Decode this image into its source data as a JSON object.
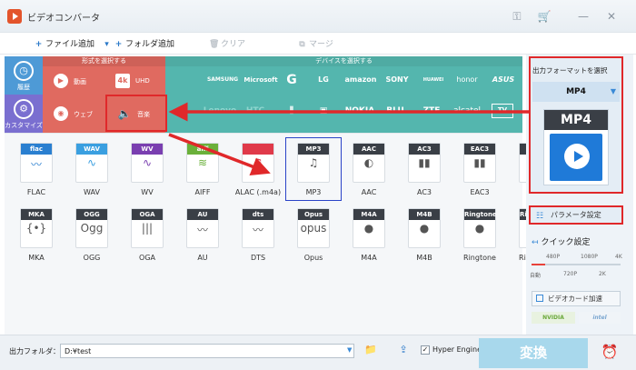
{
  "app": {
    "title": "ビデオコンバータ"
  },
  "window_icons": [
    "key-icon",
    "cart-icon",
    "minimize-icon",
    "close-icon"
  ],
  "toolbar": {
    "add_file": "ファイル追加",
    "add_folder": "フォルダ追加",
    "clear": "クリア",
    "merge": "マージ"
  },
  "nav": {
    "history": "履歴",
    "customize": "カスタマイズ"
  },
  "format_panel": {
    "header": "形式を選択する",
    "video": "動画",
    "uhd": "UHD",
    "web": "ウェブ",
    "music": "音楽"
  },
  "device_panel": {
    "header": "デバイスを選択する",
    "brands_row1": [
      "",
      "SAMSUNG",
      "Microsoft",
      "G",
      "LG",
      "amazon",
      "SONY",
      "HUAWEI",
      "honor",
      "ASUS"
    ],
    "brands_row2": [
      "Lenovo",
      "HTC",
      "",
      "",
      "NOKIA",
      "BLU",
      "ZTE",
      "alcatel",
      "TV"
    ]
  },
  "formats": [
    {
      "badge": "flac",
      "label": "FLAC",
      "color": "#2a7fd0"
    },
    {
      "badge": "WAV",
      "label": "WAV",
      "color": "#3a9fe0"
    },
    {
      "badge": "WV",
      "label": "WV",
      "color": "#7a3fb0"
    },
    {
      "badge": "aiff",
      "label": "AIFF",
      "color": "#6ab03a"
    },
    {
      "badge": "",
      "label": "ALAC (.m4a)",
      "color": "#e03a4a"
    },
    {
      "badge": "MP3",
      "label": "MP3",
      "color": "#3a3f46"
    },
    {
      "badge": "AAC",
      "label": "AAC",
      "color": "#3a3f46"
    },
    {
      "badge": "AC3",
      "label": "AC3",
      "color": "#3a3f46"
    },
    {
      "badge": "EAC3",
      "label": "EAC3",
      "color": "#3a3f46"
    },
    {
      "badge": "WMA",
      "label": "WMA",
      "color": "#3a3f46"
    },
    {
      "badge": "MKA",
      "label": "MKA",
      "color": "#3a3f46"
    },
    {
      "badge": "OGG",
      "label": "OGG",
      "color": "#3a3f46"
    },
    {
      "badge": "OGA",
      "label": "OGA",
      "color": "#3a3f46"
    },
    {
      "badge": "AU",
      "label": "AU",
      "color": "#3a3f46"
    },
    {
      "badge": "dts",
      "label": "DTS",
      "color": "#3a3f46"
    },
    {
      "badge": "Opus",
      "label": "Opus",
      "color": "#3a3f46"
    },
    {
      "badge": "M4A",
      "label": "M4A",
      "color": "#3a3f46"
    },
    {
      "badge": "M4B",
      "label": "M4B",
      "color": "#3a3f46"
    },
    {
      "badge": "Ringtone",
      "label": "Ringtone",
      "color": "#3a3f46"
    },
    {
      "badge": "Ringtone",
      "label": "Ringtone",
      "color": "#3a3f46"
    }
  ],
  "right_panel": {
    "output_format_title": "出力フォーマットを選択",
    "selected_format": "MP4",
    "icon_badge": "MP4",
    "param_settings": "パラメータ設定",
    "quick_settings": "クイック設定",
    "quality_top": [
      "480P",
      "1080P",
      "4K"
    ],
    "quality_bottom": [
      "自動",
      "720P",
      "2K"
    ],
    "quality_level": 0.15,
    "hw_accel": "ビデオカード加速",
    "gpu": [
      "NVIDIA",
      "intel"
    ]
  },
  "bottom": {
    "output_folder_label": "出力フォルダ：",
    "output_folder_value": "D:¥test",
    "hyper_engine": "Hyper Engine",
    "convert": "変換"
  },
  "colors": {
    "accent_red": "#e0282a",
    "format_panel": "#e06a60",
    "device_panel": "#54b6ae",
    "convert": "#a8d8ec"
  }
}
